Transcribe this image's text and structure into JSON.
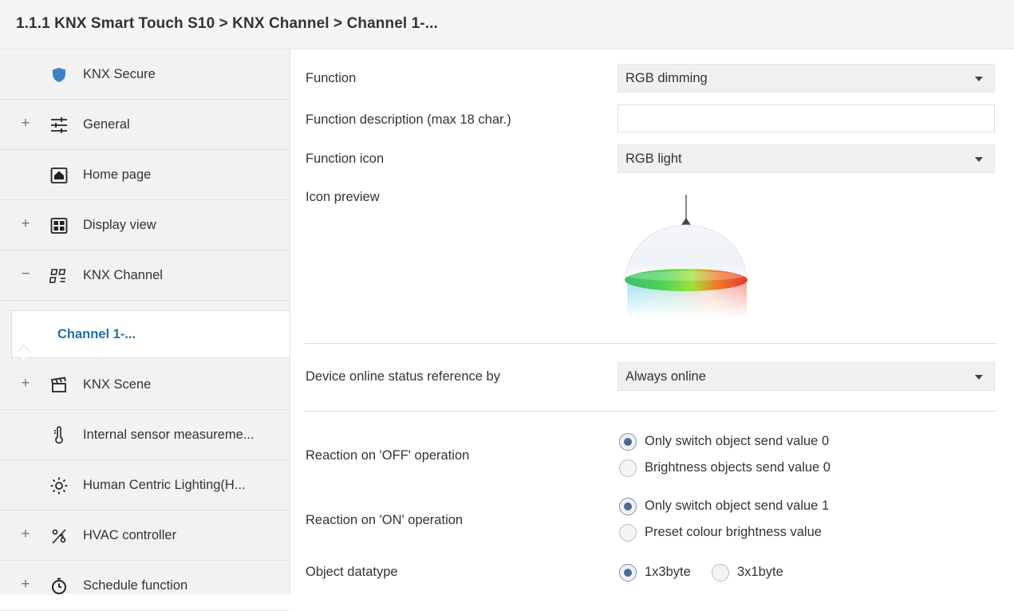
{
  "breadcrumb": "1.1.1 KNX Smart Touch S10 > KNX Channel  > Channel 1-...",
  "sidebar": {
    "items": [
      {
        "expander": "",
        "label": "KNX Secure",
        "icon": "shield-icon"
      },
      {
        "expander": "+",
        "label": "General",
        "icon": "sliders-icon"
      },
      {
        "expander": "",
        "label": "Home page",
        "icon": "home-icon"
      },
      {
        "expander": "+",
        "label": "Display view",
        "icon": "grid-view-icon"
      },
      {
        "expander": "−",
        "label": "KNX Channel",
        "icon": "channel-icon"
      },
      {
        "expander": "",
        "label": "Channel 1-...",
        "icon": ""
      },
      {
        "expander": "+",
        "label": "KNX Scene",
        "icon": "clapperboard-icon"
      },
      {
        "expander": "",
        "label": "Internal sensor measureme...",
        "icon": "thermometer-icon"
      },
      {
        "expander": "",
        "label": "Human Centric Lighting(H...",
        "icon": "sun-icon"
      },
      {
        "expander": "+",
        "label": "HVAC controller",
        "icon": "hvac-icon"
      },
      {
        "expander": "+",
        "label": "Schedule function",
        "icon": "clock-icon"
      }
    ]
  },
  "main": {
    "function": {
      "label": "Function",
      "value": "RGB dimming"
    },
    "description": {
      "label": "Function description (max 18 char.)",
      "value": ""
    },
    "function_icon": {
      "label": "Function icon",
      "value": "RGB light"
    },
    "icon_preview": {
      "label": "Icon preview",
      "icon": "rgb-pendant-lamp-icon"
    },
    "online_status": {
      "label": "Device online status reference by",
      "value": "Always online"
    },
    "reaction_off": {
      "label": "Reaction on 'OFF' operation",
      "options": [
        "Only switch object send value 0",
        "Brightness objects send value 0"
      ],
      "selected": 0
    },
    "reaction_on": {
      "label": "Reaction on 'ON' operation",
      "options": [
        "Only switch object send value 1",
        "Preset colour brightness value"
      ],
      "selected": 0
    },
    "datatype": {
      "label": "Object datatype",
      "options": [
        "1x3byte",
        "3x1byte"
      ],
      "selected": 0
    }
  },
  "colors": {
    "accent": "#1f6fab",
    "shield": "#3b82c4",
    "radio_selected": "#4a6a96"
  }
}
